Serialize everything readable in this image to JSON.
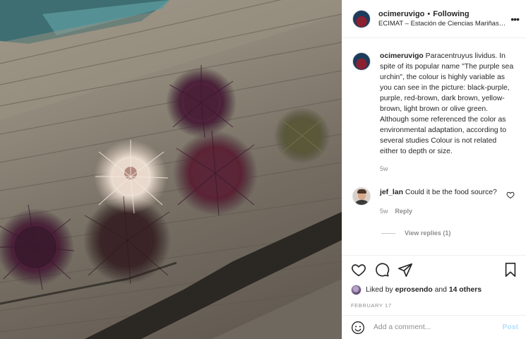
{
  "post": {
    "username": "ocimeruvigo",
    "separator": "•",
    "follow_status": "Following",
    "location": "ECIMAT – Estación de Ciencias Mariñas de Toralla",
    "more_icon": "more-horizontal-icon",
    "photo_alt": "Sea urchins on weathered wooden board"
  },
  "caption": {
    "username": "ocimeruvigo",
    "text": "Paracentruyus lividus. In spite of its popular name \"The purple sea urchin\", the colour is highly variable as you can see in the picture: black-purple, purple, red-brown, dark brown, yellow-brown, light brown or olive green. Although some referenced the color as environmental adaptation, according to several studies Colour is not related either to depth or size.",
    "age": "5w"
  },
  "comment": {
    "username": "jef_lan",
    "text": "Could it be the food source?",
    "age": "5w",
    "reply_label": "Reply",
    "view_replies": "View replies (1)"
  },
  "actions": {
    "icons": [
      "heart-icon",
      "comment-icon",
      "share-icon",
      "bookmark-icon"
    ],
    "liked_prefix": "Liked by",
    "liked_user": "eprosendo",
    "liked_and": "and",
    "liked_others": "14 others",
    "date": "FEBRUARY 17"
  },
  "add_comment": {
    "placeholder": "Add a comment...",
    "post_label": "Post",
    "emoji_icon": "emoji-icon"
  },
  "colors": {
    "text": "#262626",
    "muted": "#8e8e8e",
    "border": "#efefef",
    "post_button": "#b2dffc"
  }
}
